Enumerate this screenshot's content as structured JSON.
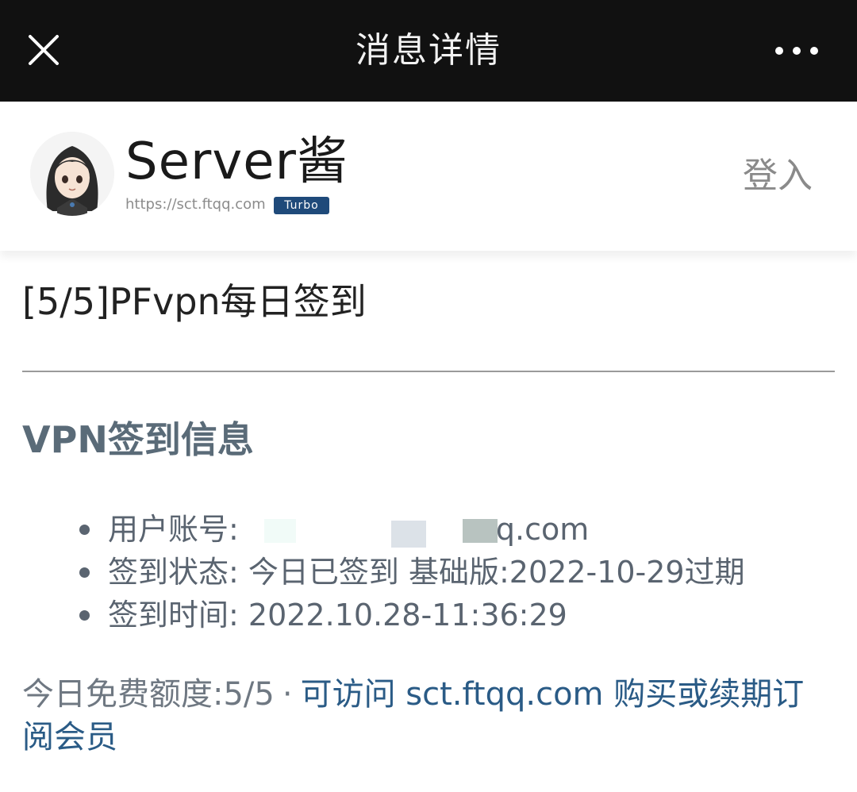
{
  "topbar": {
    "title": "消息详情"
  },
  "header": {
    "brand_name": "Server酱",
    "brand_url": "https://sct.ftqq.com",
    "badge": "Turbo",
    "login_label": "登入"
  },
  "message": {
    "title": "[5/5]PFvpn每日签到",
    "section_heading": "VPN签到信息",
    "items": [
      {
        "label": "用户账号: ",
        "value": "q.com"
      },
      {
        "label": "签到状态: ",
        "value": "今日已签到 基础版:2022-10-29过期"
      },
      {
        "label": "签到时间: ",
        "value": "2022.10.28-11:36:29"
      }
    ],
    "quota_text": "今日免费额度:5/5",
    "separator": "·",
    "link_text": "可访问 sct.ftqq.com 购买或续期订阅会员"
  },
  "icons": {
    "close": "close-icon",
    "more": "more-dots-icon",
    "avatar": "anime-girl-avatar"
  },
  "colors": {
    "topbar_bg": "#111111",
    "badge_bg": "#1f4a7a",
    "link": "#2a5b86",
    "heading": "#5a6b78"
  }
}
